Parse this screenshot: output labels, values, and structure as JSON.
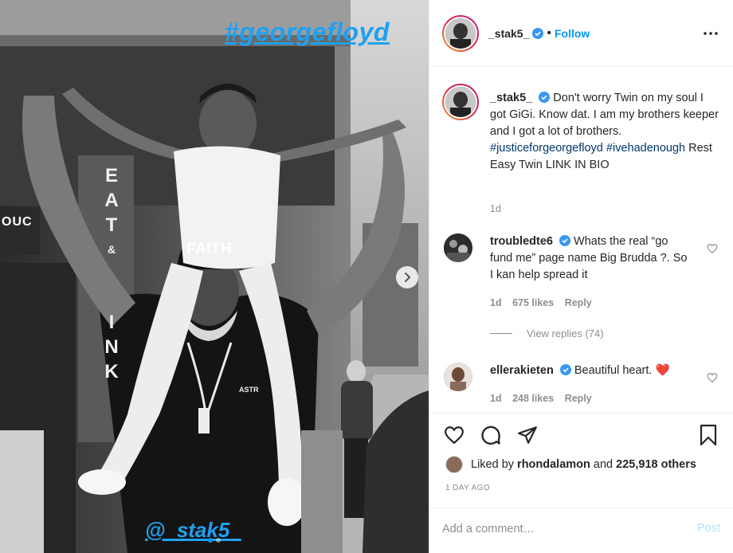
{
  "photo": {
    "overlay_hashtag": "#georgefloyd",
    "overlay_mention": "@_stak5_",
    "cap_text": "FAITH",
    "sign_letters": [
      "E",
      "A",
      "T",
      "&",
      "I",
      "N",
      "K"
    ],
    "store_text": "OUC",
    "shirt_text": "ASTR",
    "carousel_total": 2,
    "carousel_index": 1,
    "next_icon": "chevron-right-icon"
  },
  "post": {
    "author": "_stak5_",
    "verified": true,
    "follow_label": "Follow",
    "more_icon": "more-horizontal-icon",
    "caption": {
      "text_1": "Don't worry Twin on my soul I got GiGi. Know dat. I am my brothers keeper and I got a lot of brothers.",
      "tag_1": "#justiceforgeorgefloyd",
      "tag_2": "#ivehadenough",
      "text_2": "Rest Easy Twin LINK IN BIO",
      "age": "1d"
    },
    "comments": [
      {
        "username": "troubledte6",
        "verified": true,
        "text": "Whats the real “go fund me” page name Big Brudda ?. So I kan help spread it",
        "age": "1d",
        "likes": "675 likes",
        "reply_label": "Reply"
      },
      {
        "username": "ellerakieten",
        "verified": true,
        "text": "Beautiful heart.",
        "emoji": "❤️",
        "age": "1d",
        "likes": "248 likes",
        "reply_label": "Reply"
      }
    ],
    "view_replies_label": "View replies (74)",
    "actions": {
      "like_icon": "heart-icon",
      "comment_icon": "comment-icon",
      "share_icon": "share-icon",
      "save_icon": "bookmark-icon"
    },
    "liked_by_prefix": "Liked by",
    "liked_by_user": "rhondalamon",
    "liked_by_and": "and",
    "liked_by_others": "225,918 others",
    "time_ago": "1 DAY AGO",
    "add_comment_placeholder": "Add a comment…",
    "post_label": "Post"
  },
  "colors": {
    "accent": "#0095f6",
    "overlay_blue": "#1ea1f2",
    "hashtag_link": "#00376b",
    "muted": "#8e8e8e",
    "heart_red": "#ed1c24"
  }
}
